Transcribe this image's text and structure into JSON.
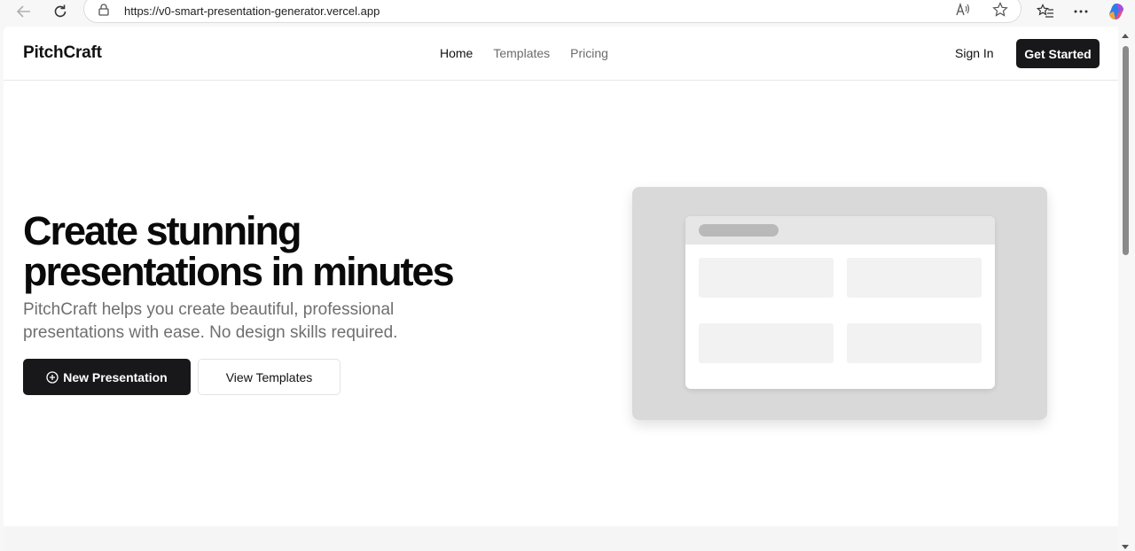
{
  "browser": {
    "url": "https://v0-smart-presentation-generator.vercel.app"
  },
  "header": {
    "logo": "PitchCraft",
    "nav": [
      {
        "label": "Home",
        "active": true
      },
      {
        "label": "Templates",
        "active": false
      },
      {
        "label": "Pricing",
        "active": false
      }
    ],
    "sign_in": "Sign In",
    "get_started": "Get Started"
  },
  "hero": {
    "title_line1": "Create stunning",
    "title_line2": "presentations in minutes",
    "subtitle": "PitchCraft helps you create beautiful, professional presentations with ease. No design skills required.",
    "primary_button": "New Presentation",
    "secondary_button": "View Templates"
  },
  "colors": {
    "primary": "#18181b",
    "muted_text": "#6f6f6f",
    "mock_bg": "#d9d9d9"
  }
}
